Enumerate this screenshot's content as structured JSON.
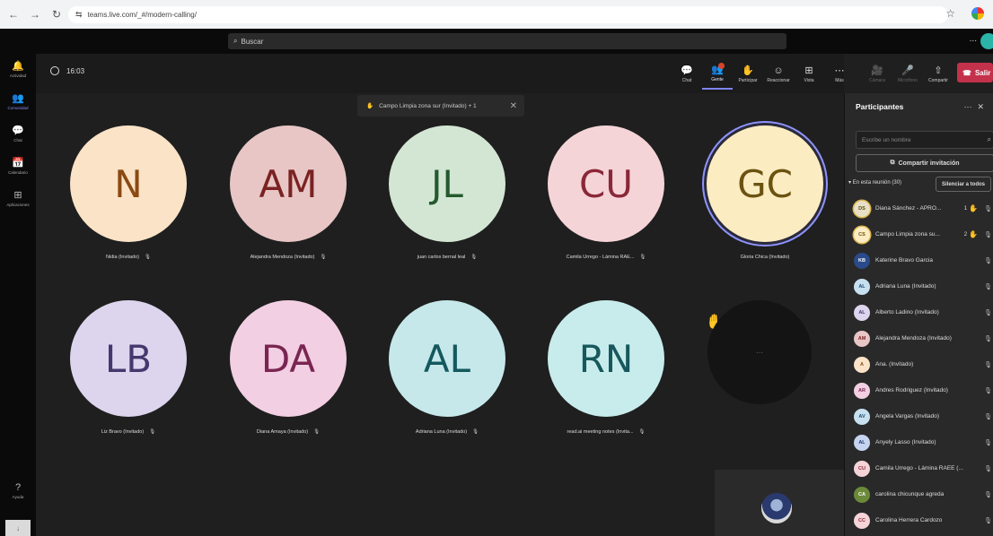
{
  "browser": {
    "url": "teams.live.com/_#/modern-calling/"
  },
  "topbar": {
    "search_placeholder": "Buscar",
    "more": "..."
  },
  "rail": {
    "items": [
      {
        "label": "Actividad",
        "icon": "bell-icon",
        "glyph": "🔔"
      },
      {
        "label": "Comunidad",
        "icon": "community-icon",
        "glyph": "👥"
      },
      {
        "label": "Chat",
        "icon": "chat-icon",
        "glyph": "💬"
      },
      {
        "label": "Calendario",
        "icon": "calendar-icon",
        "glyph": "📅"
      },
      {
        "label": "Aplicaciones",
        "icon": "apps-icon",
        "glyph": "⊞"
      }
    ],
    "help_label": "Ayuda",
    "help_glyph": "?"
  },
  "meeting": {
    "timer": "16:03",
    "tools": [
      {
        "label": "Chat",
        "icon": "chat-icon",
        "glyph": "💬"
      },
      {
        "label": "Gente",
        "icon": "people-icon",
        "glyph": "👥"
      },
      {
        "label": "Participar",
        "icon": "hand-icon",
        "glyph": "✋"
      },
      {
        "label": "Reaccionar",
        "icon": "react-icon",
        "glyph": "☺"
      },
      {
        "label": "Vista",
        "icon": "view-icon",
        "glyph": "⊞"
      },
      {
        "label": "Más",
        "icon": "more-icon",
        "glyph": "⋯"
      },
      {
        "label": "Cámara",
        "icon": "camera-icon",
        "glyph": "🎥"
      },
      {
        "label": "Micrófono",
        "icon": "mic-icon",
        "glyph": "🎤"
      },
      {
        "label": "Compartir",
        "icon": "share-icon",
        "glyph": "⇧"
      }
    ],
    "leave_label": "Salir",
    "notice": "Campo Limpia zona sur (Invitado) + 1"
  },
  "tiles": [
    {
      "initials": "N",
      "name": "Nidia (Invitado)",
      "bg": "#fbe3c7",
      "fg": "#8a4a12"
    },
    {
      "initials": "AM",
      "name": "Alejandra Mendoza (Invitado)",
      "bg": "#e8c6c6",
      "fg": "#7a2222"
    },
    {
      "initials": "JL",
      "name": "juan carlos bernal leal",
      "bg": "#d3e6d4",
      "fg": "#245a2d"
    },
    {
      "initials": "CU",
      "name": "Camila Urrego - Lámina RAE...",
      "bg": "#f5d4d8",
      "fg": "#8a2838"
    },
    {
      "initials": "GC",
      "name": "Gloria Chica (Invitado)",
      "bg": "#fbecc2",
      "fg": "#6b5210"
    },
    {
      "initials": "LB",
      "name": "Liz Bravo (Invitado)",
      "bg": "#ddd5ee",
      "fg": "#45386e"
    },
    {
      "initials": "DA",
      "name": "Diana Amaya (Invitado)",
      "bg": "#f2cfe2",
      "fg": "#7a2552"
    },
    {
      "initials": "AL",
      "name": "Adriana Luna (Invitado)",
      "bg": "#c6e8ea",
      "fg": "#13595e"
    },
    {
      "initials": "RN",
      "name": "read.ai meeting notes (Invita...",
      "bg": "#c8ecec",
      "fg": "#17585c"
    }
  ],
  "blank_tile": {
    "glyph": "···"
  },
  "panel": {
    "title": "Participantes",
    "search_placeholder": "Escribe un nombre",
    "invite_label": "Compartir invitación",
    "in_meeting": "En esta reunión (30)",
    "mute_all": "Silenciar a todos",
    "participants": [
      {
        "initials": "DS",
        "name": "Diana Sánchez - APRO...",
        "bg": "#e8e0c6",
        "fg": "#5a4a12",
        "hand": "1",
        "ring": true
      },
      {
        "initials": "CS",
        "name": "Campo Limpia zona su...",
        "bg": "#fbecc2",
        "fg": "#6b5210",
        "hand": "2",
        "ring": true
      },
      {
        "initials": "KB",
        "name": "Katerine Bravo Garcia",
        "bg": "#2a4a8a",
        "fg": "#ffffff",
        "hand": "",
        "ring": false
      },
      {
        "initials": "AL",
        "name": "Adriana Luna (Invitado)",
        "bg": "#c6e0f0",
        "fg": "#1a4a6e",
        "hand": "",
        "ring": false
      },
      {
        "initials": "AL",
        "name": "Alberto Ladino (Invitado)",
        "bg": "#ddd5ee",
        "fg": "#45386e",
        "hand": "",
        "ring": false
      },
      {
        "initials": "AM",
        "name": "Alejandra Mendoza (Invitado)",
        "bg": "#e8c6c6",
        "fg": "#7a2222",
        "hand": "",
        "ring": false
      },
      {
        "initials": "A",
        "name": "Ana. (Invitado)",
        "bg": "#fbe3c7",
        "fg": "#8a4a12",
        "hand": "",
        "ring": false
      },
      {
        "initials": "AR",
        "name": "Andres Rodriguez (Invitado)",
        "bg": "#f2cfe2",
        "fg": "#7a2552",
        "hand": "",
        "ring": false
      },
      {
        "initials": "AV",
        "name": "Angela Vargas (Invitado)",
        "bg": "#c6e0f0",
        "fg": "#1a4a6e",
        "hand": "",
        "ring": false
      },
      {
        "initials": "AL",
        "name": "Anyely Lasso (Invitado)",
        "bg": "#c6d4f0",
        "fg": "#1a3a6e",
        "hand": "",
        "ring": false
      },
      {
        "initials": "CU",
        "name": "Camila Urrego - Lámina RAEE (...",
        "bg": "#f5d4d8",
        "fg": "#8a2838",
        "hand": "",
        "ring": false
      },
      {
        "initials": "CA",
        "name": "carolina chicunque agreda",
        "bg": "#6a8a3a",
        "fg": "#ffffff",
        "hand": "",
        "ring": false
      },
      {
        "initials": "CC",
        "name": "Carolina Herrera Cardozo",
        "bg": "#f5d4d8",
        "fg": "#8a2838",
        "hand": "",
        "ring": false
      }
    ]
  }
}
